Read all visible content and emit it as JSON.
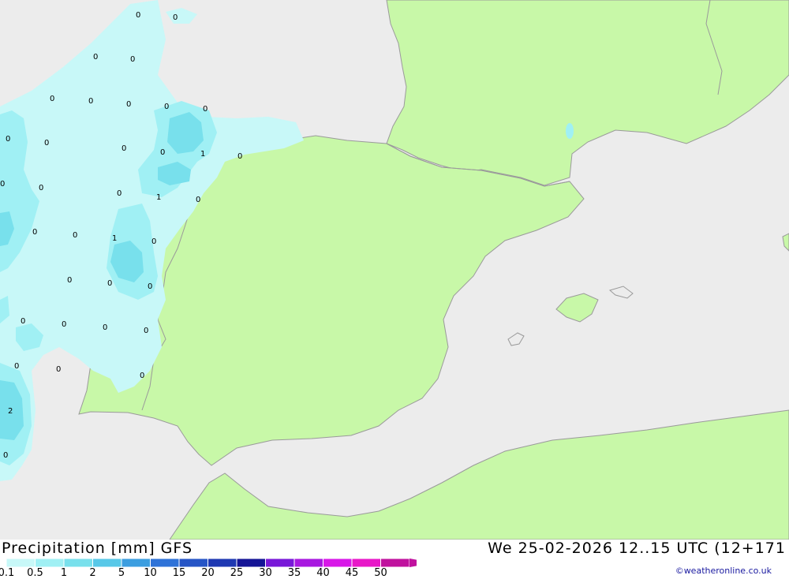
{
  "title": {
    "left": "Precipitation [mm] GFS",
    "right": "We 25-02-2026 12..15 UTC (12+171"
  },
  "credit": "©weatheronline.co.uk",
  "colors": {
    "sea": "#ececec",
    "land": "#c8f8a8",
    "coast": "#9a9a9a",
    "precip_0_1": "#c8f8f8",
    "precip_0_5": "#a0f0f4",
    "precip_1": "#78e0ec",
    "precip_2": "#58c8e8"
  },
  "legend": {
    "labels": [
      "0.1",
      "0.5",
      "1",
      "2",
      "5",
      "10",
      "15",
      "20",
      "25",
      "30",
      "35",
      "40",
      "45",
      "50"
    ],
    "colors": [
      "#c8f8f8",
      "#a0f0f4",
      "#78e0ec",
      "#58c8e8",
      "#3c9ee0",
      "#2f73d8",
      "#2655c6",
      "#1e38b2",
      "#141496",
      "#7818d8",
      "#a818e0",
      "#d818e8",
      "#e818c8",
      "#c0129e"
    ]
  },
  "map_labels": [
    "0",
    "0",
    "0",
    "0",
    "0",
    "0",
    "0",
    "0",
    "0",
    "0",
    "0",
    "0",
    "1",
    "0",
    "0",
    "0",
    "0",
    "1",
    "0",
    "0",
    "0",
    "1",
    "0",
    "0",
    "0",
    "0",
    "0",
    "0",
    "0",
    "0",
    "0",
    "0",
    "0",
    "2",
    "0"
  ]
}
